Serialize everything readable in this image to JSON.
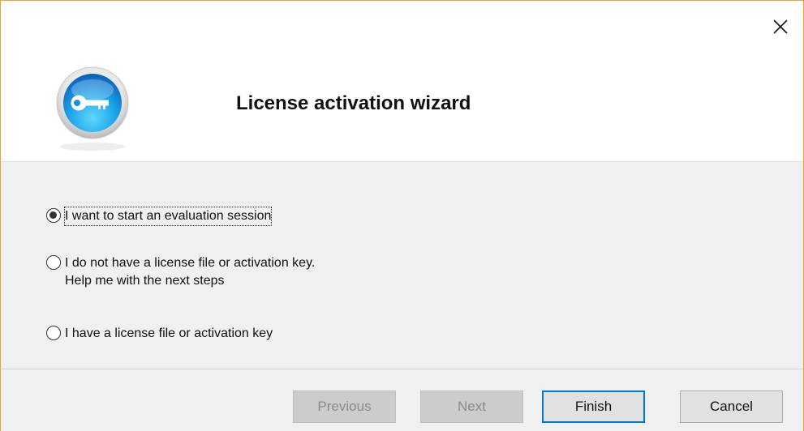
{
  "window": {
    "title": "License activation wizard",
    "close_icon": "close-icon",
    "logo_icon": "key-icon"
  },
  "options": [
    {
      "lines": [
        "I want to start an evaluation session"
      ],
      "checked": true
    },
    {
      "lines": [
        "I do not have a license file or activation key.",
        "Help me with the next steps"
      ],
      "checked": false
    },
    {
      "lines": [
        "I have a license file or activation key"
      ],
      "checked": false
    }
  ],
  "buttons": {
    "previous": "Previous",
    "next": "Next",
    "finish": "Finish",
    "cancel": "Cancel"
  },
  "colors": {
    "window_border": "#e8a33d",
    "default_button_border": "#0078d7",
    "logo_blue": "#1e88e5"
  }
}
